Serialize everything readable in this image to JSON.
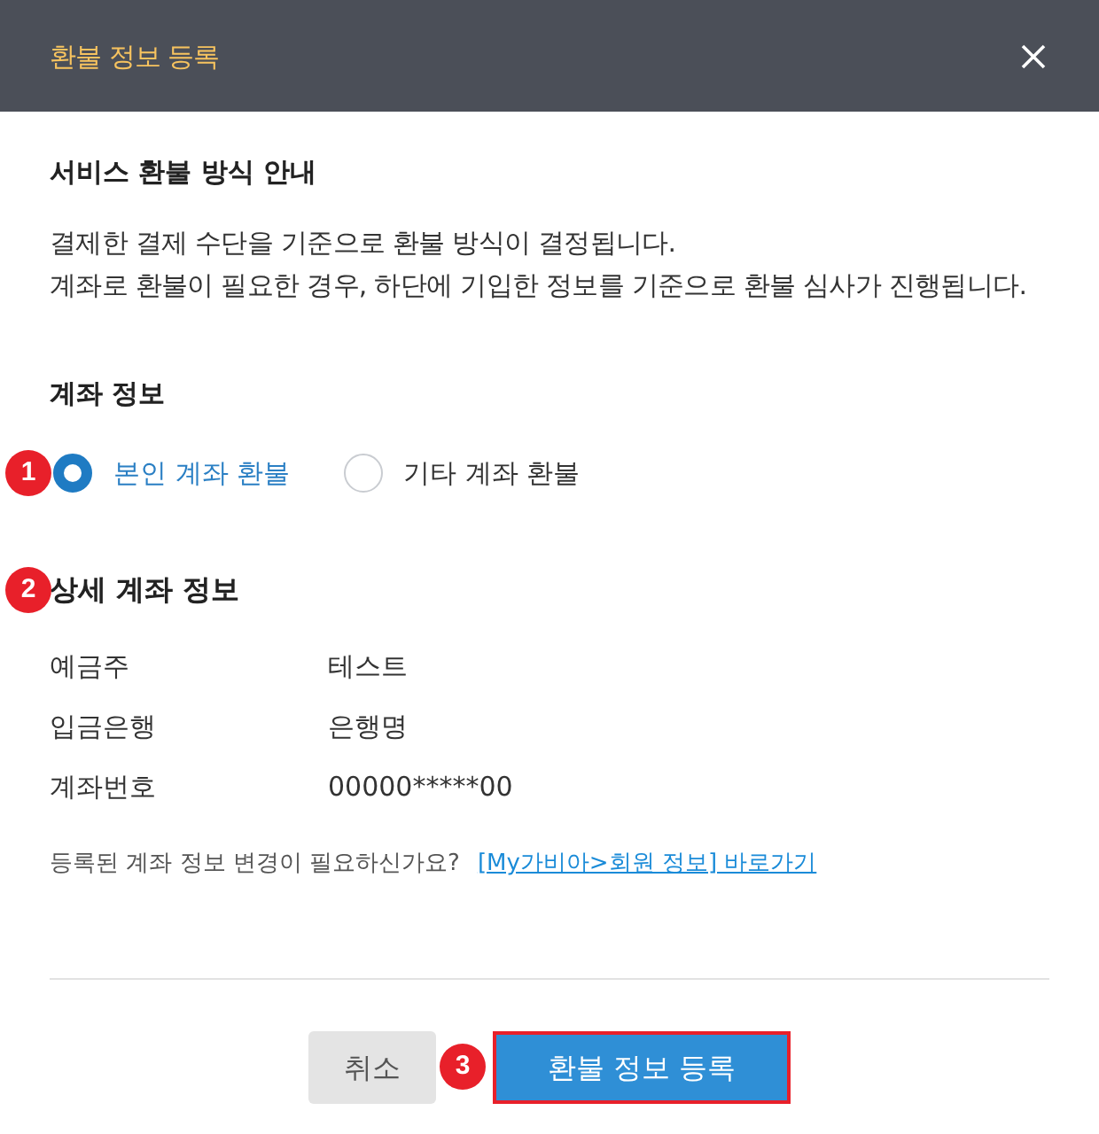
{
  "dialog": {
    "title": "환불 정보 등록"
  },
  "info_section": {
    "title": "서비스 환불 방식 안내",
    "lines": [
      "결제한 결제 수단을 기준으로 환불 방식이 결정됩니다.",
      "계좌로 환불이 필요한 경우, 하단에 기입한 정보를 기준으로 환불 심사가 진행됩니다."
    ]
  },
  "account_section": {
    "title": "계좌 정보",
    "marker": "1",
    "options": [
      {
        "label": "본인 계좌 환불",
        "selected": true
      },
      {
        "label": "기타 계좌 환불",
        "selected": false
      }
    ]
  },
  "detail_section": {
    "title": "상세 계좌 정보",
    "marker": "2",
    "rows": [
      {
        "label": "예금주",
        "value": "테스트"
      },
      {
        "label": "입금은행",
        "value": "은행명"
      },
      {
        "label": "계좌번호",
        "value": "00000*****00"
      }
    ],
    "note": "등록된 계좌 정보 변경이 필요하신가요?",
    "link": "[My가비아>회원 정보] 바로가기"
  },
  "buttons": [
    {
      "kind": "secondary",
      "label": "취소",
      "highlighted": false
    },
    {
      "kind": "primary",
      "label": "환불 정보 등록",
      "marker": "3",
      "highlighted": true
    }
  ]
}
